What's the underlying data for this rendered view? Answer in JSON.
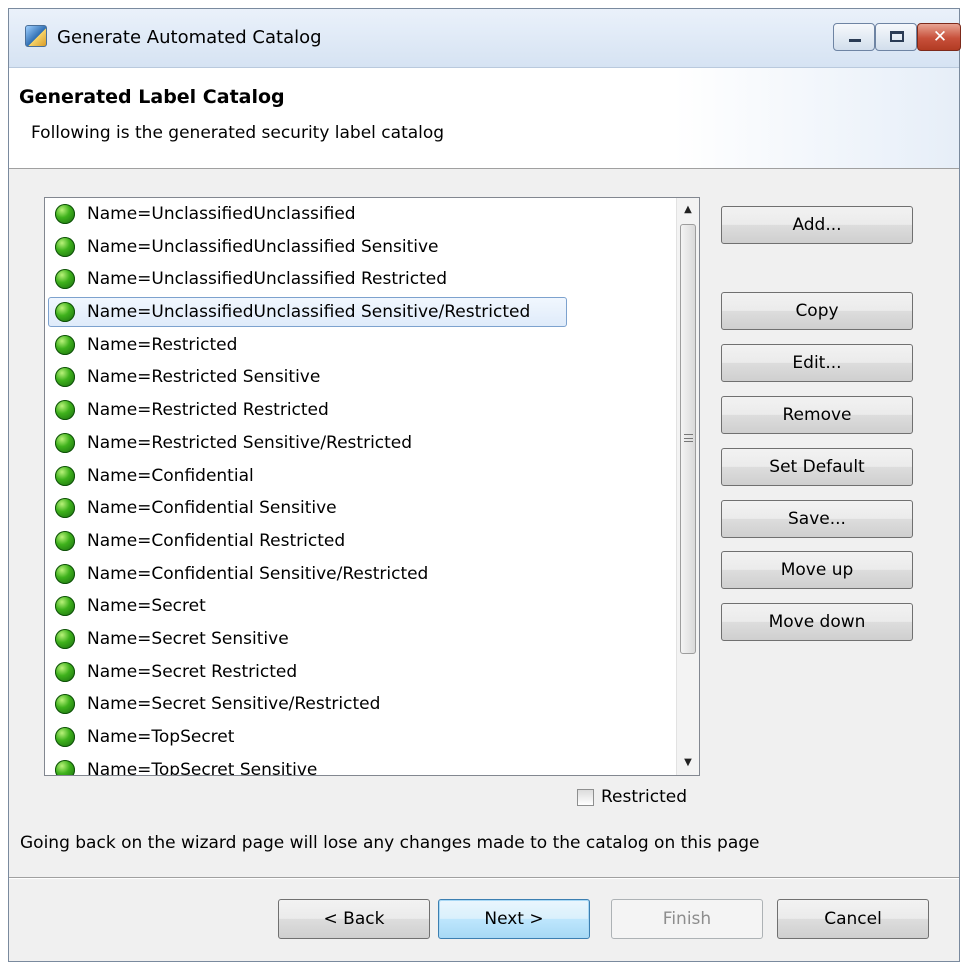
{
  "window": {
    "title": "Generate Automated Catalog",
    "close_glyph": "✕"
  },
  "header": {
    "title": "Generated Label Catalog",
    "subtitle": "Following is the generated security label catalog"
  },
  "catalog": {
    "items": [
      {
        "label": "Name=UnclassifiedUnclassified",
        "icon": "green-circle-icon",
        "selected": false
      },
      {
        "label": "Name=UnclassifiedUnclassified Sensitive",
        "icon": "green-circle-icon",
        "selected": false
      },
      {
        "label": "Name=UnclassifiedUnclassified Restricted",
        "icon": "green-circle-icon",
        "selected": false
      },
      {
        "label": "Name=UnclassifiedUnclassified Sensitive/Restricted",
        "icon": "green-circle-icon",
        "selected": true
      },
      {
        "label": "Name=Restricted",
        "icon": "green-circle-icon",
        "selected": false
      },
      {
        "label": "Name=Restricted Sensitive",
        "icon": "green-circle-icon",
        "selected": false
      },
      {
        "label": "Name=Restricted Restricted",
        "icon": "green-circle-icon",
        "selected": false
      },
      {
        "label": "Name=Restricted Sensitive/Restricted",
        "icon": "green-circle-icon",
        "selected": false
      },
      {
        "label": "Name=Confidential",
        "icon": "green-circle-icon",
        "selected": false
      },
      {
        "label": "Name=Confidential Sensitive",
        "icon": "green-circle-icon",
        "selected": false
      },
      {
        "label": "Name=Confidential Restricted",
        "icon": "green-circle-icon",
        "selected": false
      },
      {
        "label": "Name=Confidential Sensitive/Restricted",
        "icon": "green-circle-icon",
        "selected": false
      },
      {
        "label": "Name=Secret",
        "icon": "green-circle-icon",
        "selected": false
      },
      {
        "label": "Name=Secret Sensitive",
        "icon": "green-circle-icon",
        "selected": false
      },
      {
        "label": "Name=Secret Restricted",
        "icon": "green-circle-icon",
        "selected": false
      },
      {
        "label": "Name=Secret Sensitive/Restricted",
        "icon": "green-circle-icon",
        "selected": false
      },
      {
        "label": "Name=TopSecret",
        "icon": "green-circle-icon",
        "selected": false
      },
      {
        "label": "Name=TopSecret Sensitive",
        "icon": "green-circle-icon",
        "selected": false
      }
    ],
    "scroll": {
      "up_glyph": "▲",
      "down_glyph": "▼"
    }
  },
  "side_buttons": {
    "add": "Add...",
    "copy": "Copy",
    "edit": "Edit...",
    "remove": "Remove",
    "set_default": "Set Default",
    "save": "Save...",
    "move_up": "Move up",
    "move_down": "Move down"
  },
  "restricted_checkbox": {
    "label": "Restricted",
    "checked": false
  },
  "note": "Going back on the wizard page will lose any changes made to the catalog on this page",
  "footer": {
    "back": "< Back",
    "next": "Next >",
    "finish": "Finish",
    "cancel": "Cancel"
  }
}
